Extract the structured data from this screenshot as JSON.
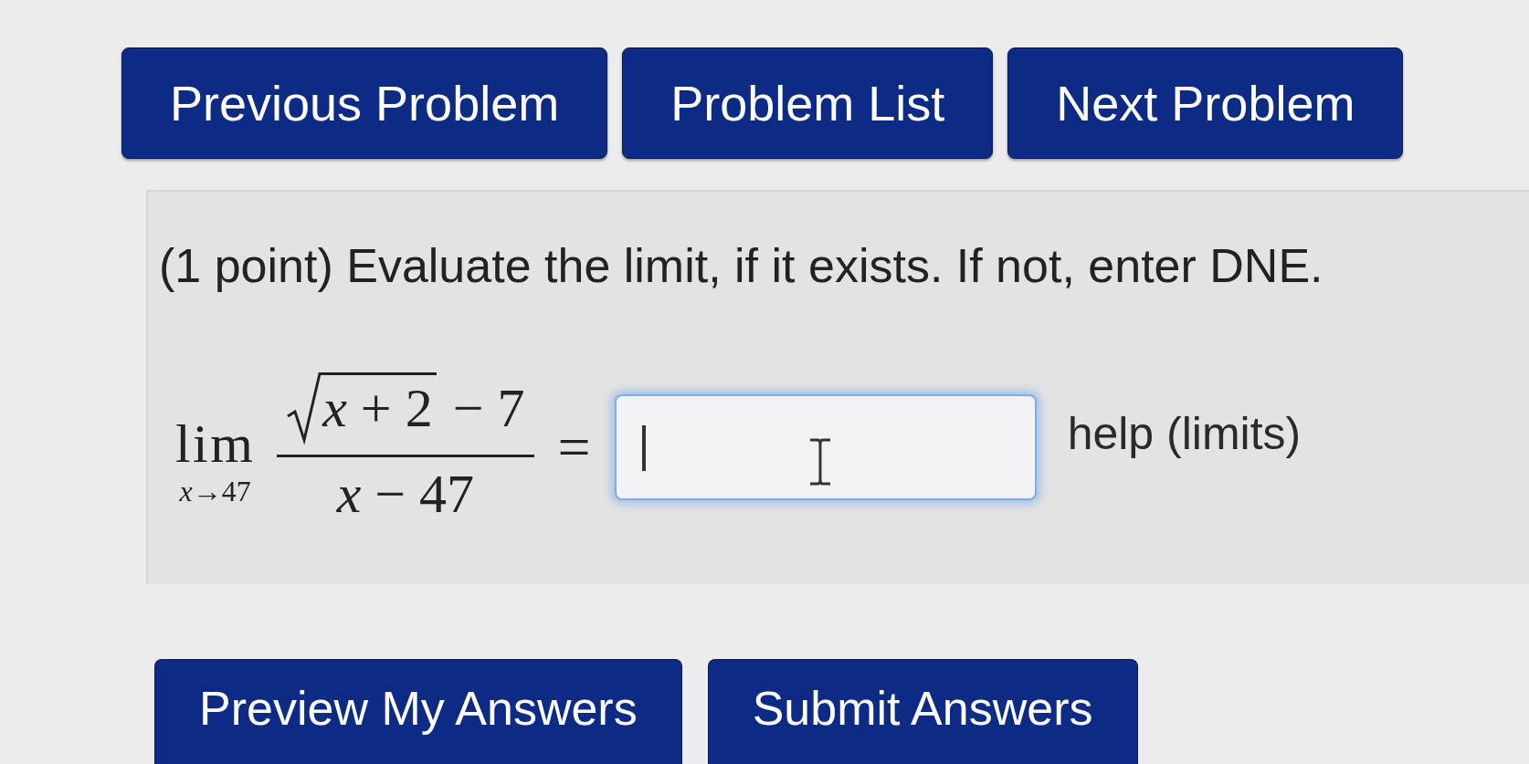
{
  "nav_buttons": [
    {
      "label": "Previous Problem"
    },
    {
      "label": "Problem List"
    },
    {
      "label": "Next Problem"
    }
  ],
  "problem": {
    "prompt": "(1 point) Evaluate the limit, if it exists. If not, enter DNE.",
    "expression": {
      "operator": "lim",
      "subscript": "*x*→47",
      "radicand": "*x* + 2",
      "numerator_rest": "− 7",
      "denominator": "*x* − 47",
      "relation": "="
    },
    "answer": {
      "focused": true
    },
    "help_link": "help (limits)"
  },
  "action_buttons": [
    {
      "label": "Preview My Answers"
    },
    {
      "label": "Submit Answers"
    }
  ]
}
